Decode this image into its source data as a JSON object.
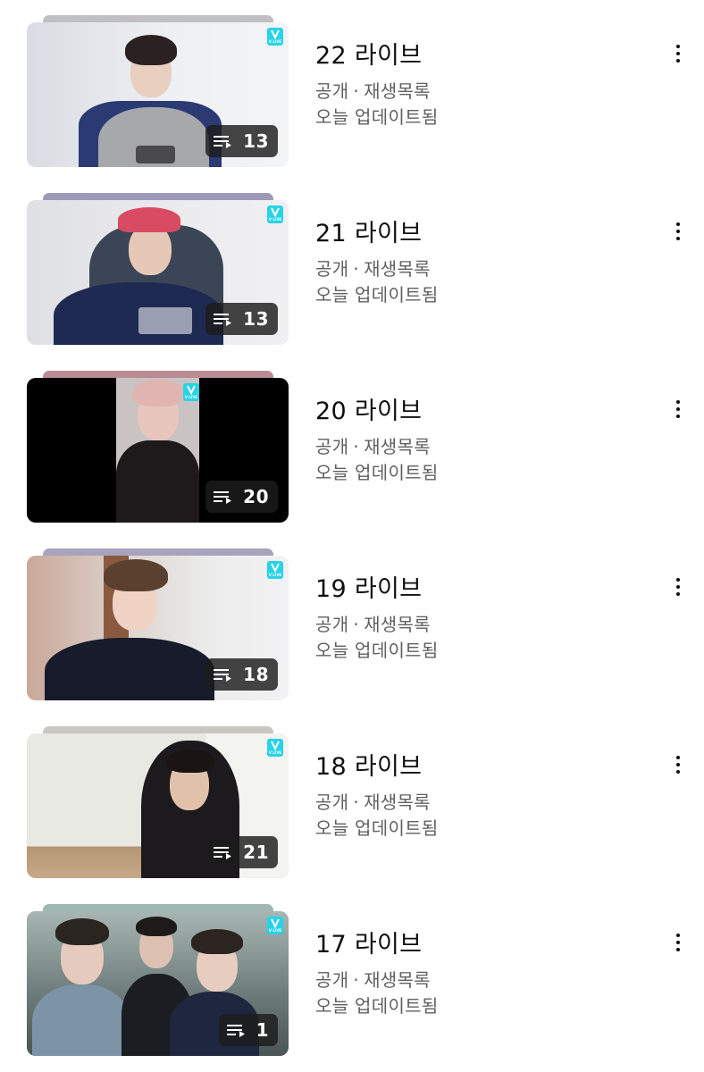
{
  "playlists": [
    {
      "title": "22 라이브",
      "visibility": "공개",
      "type": "재생목록",
      "updated": "오늘 업데이트됨",
      "video_count": "13",
      "stack_color": "#bfbfc4"
    },
    {
      "title": "21 라이브",
      "visibility": "공개",
      "type": "재생목록",
      "updated": "오늘 업데이트됨",
      "video_count": "13",
      "stack_color": "#9b9ab8"
    },
    {
      "title": "20 라이브",
      "visibility": "공개",
      "type": "재생목록",
      "updated": "오늘 업데이트됨",
      "video_count": "20",
      "stack_color": "#b98b94"
    },
    {
      "title": "19 라이브",
      "visibility": "공개",
      "type": "재생목록",
      "updated": "오늘 업데이트됨",
      "video_count": "18",
      "stack_color": "#a7a3bd"
    },
    {
      "title": "18 라이브",
      "visibility": "공개",
      "type": "재생목록",
      "updated": "오늘 업데이트됨",
      "video_count": "21",
      "stack_color": "#c9c7c2"
    },
    {
      "title": "17 라이브",
      "visibility": "공개",
      "type": "재생목록",
      "updated": "오늘 업데이트됨",
      "video_count": "1",
      "stack_color": "#9fb8b4"
    }
  ],
  "separator": "·",
  "thumbnail_badge_icon": "playlist-play-icon",
  "channel_logo_icon": "vlive-logo-icon",
  "more_icon": "more-vert-icon",
  "vlive_logo_text": "V LIVE"
}
